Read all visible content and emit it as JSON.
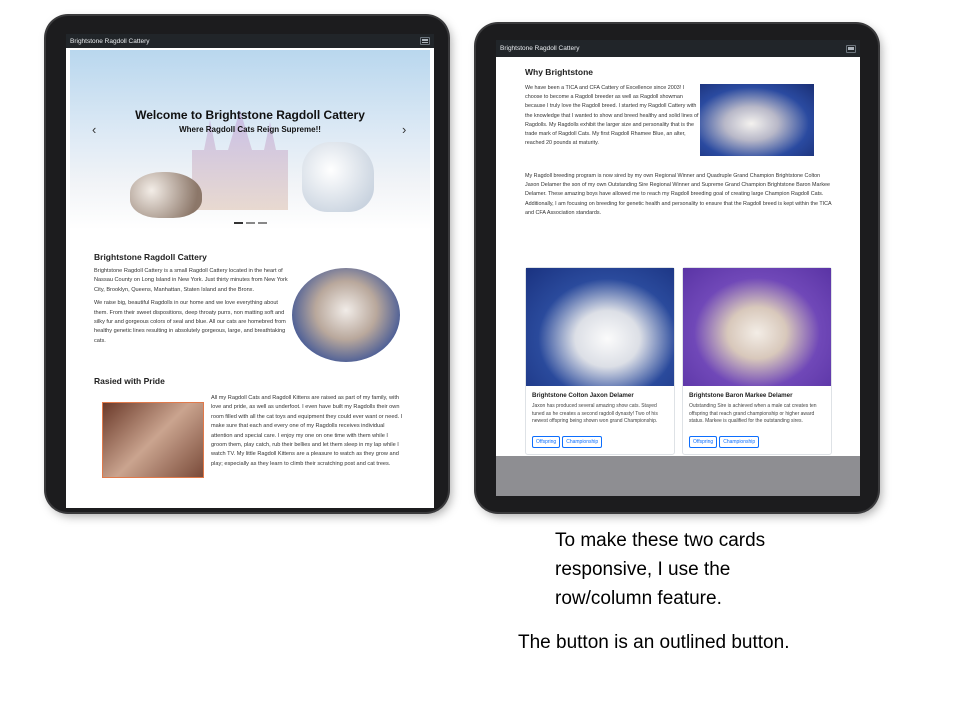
{
  "left_tablet": {
    "navbar": {
      "brand": "Brightstone Ragdoll Cattery"
    },
    "hero": {
      "title": "Welcome to Brightstone Ragdoll Cattery",
      "subtitle": "Where Ragdoll Cats Reign Supreme!!",
      "prev_glyph": "‹",
      "next_glyph": "›"
    },
    "about": {
      "heading": "Brightstone Ragdoll Cattery",
      "p1": "Brightstone Ragdoll Cattery is a small Ragdoll Cattery located in the heart of Nassau County on Long Island in New York. Just thirty minutes from New York City, Brooklyn, Queens, Manhattan, Staten Island and the Bronx.",
      "p2": "We raise big, beautiful Ragdolls in our home and we love everything about them. From their sweet dispositions, deep throaty purrs, non matting soft and silky fur and gorgeous colors of seal and blue. All our cats are homebred from healthy genetic lines resulting in absolutely gorgeous, large, and breathtaking cats."
    },
    "pride": {
      "heading": "Rasied with Pride",
      "p1": "All my Ragdoll Cats and Ragdoll Kittens are raised as part of my family, with love and pride, as well as underfoot. I even have built my Ragdolls their own room filled with all the cat toys and equipment they could ever want or need. I make sure that each and every one of my Ragdolls receives individual attention and special care. I enjoy my one on one time with them while I groom them, play catch, rub their bellies and let them sleep in my lap while I watch TV. My little Ragdoll Kittens are a pleasure to watch as they grow and play; especially as they learn to climb their scratching post and cat trees."
    }
  },
  "right_tablet": {
    "navbar": {
      "brand": "Brightstone Ragdoll Cattery"
    },
    "why": {
      "heading": "Why Brightstone",
      "p1": "We have been a TICA and CFA Cattery of Excellence since 2003! I choose to become a Ragdoll breeder as well as Ragdoll showman because I truly love the Ragdoll breed. I started my Ragdoll Cattery with the knowledge that I wanted to show and breed healthy and solid lines of Ragdolls. My Ragdolls exhibit the larger size and personality that is the trade mark of Ragdoll Cats. My first Ragdoll Rhamee Blue, an alter, reached 20 pounds at maturity.",
      "p2": "My Ragdoll breeding program is now sired by my own Regional Winner and Quadruple Grand Champion Brightstone Colton Jaxon Delamer the son of my own Outstanding Sire Regional Winner and Supreme Grand Champion Brightstone Baron Markee Delamer. These amazing boys have allowed me to reach my Ragdoll breeding goal of creating large Champion Ragdoll Cats. Additionally, I am focusing on breeding for genetic health and personality to ensure that the Ragdoll breed is kept within the TICA and CFA Association standards."
    },
    "cards": [
      {
        "title": "Brightstone Colton Jaxon Delamer",
        "text": "Jaxon has produced several amazing show cats. Stayed tuned as he creates a second ragdoll dynasty! Two of his newest offspring being shown won grand Championship.",
        "btn1": "Offspring",
        "btn2": "Championship"
      },
      {
        "title": "Brightstone Baron Markee Delamer",
        "text": "Outstanding Sire is achieved when a male cat creates ten offspring that reach grand championship or higher award status. Markee is qualified for the outstanding sires.",
        "btn1": "Offspring",
        "btn2": "Championship"
      }
    ]
  },
  "captions": {
    "line1": "To make these two cards",
    "line2": "responsive, I use the",
    "line3": "row/column feature.",
    "line4": "The button is an outlined button."
  },
  "colors": {
    "navbar_bg": "#212529",
    "outline_button": "#0d6efd",
    "card_image_left_bg": "#1f3f8f",
    "card_image_right_bg": "#6a3fb5"
  }
}
